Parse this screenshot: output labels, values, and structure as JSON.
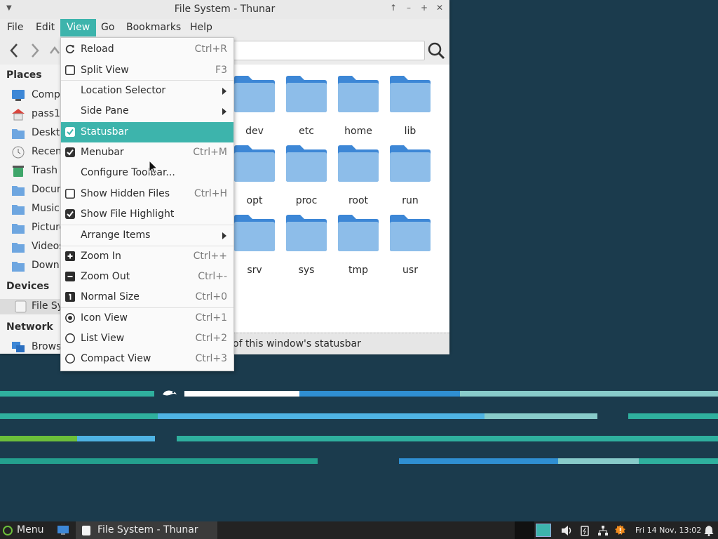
{
  "window": {
    "title": "File System - Thunar",
    "menubar": [
      "File",
      "Edit",
      "View",
      "Go",
      "Bookmarks",
      "Help"
    ],
    "active_menu": "View"
  },
  "sidebar": {
    "places_header": "Places",
    "places": [
      {
        "label": "Computer",
        "icon": "computer-icon"
      },
      {
        "label": "pass123",
        "icon": "home-icon"
      },
      {
        "label": "Desktop",
        "icon": "desktop-folder-icon"
      },
      {
        "label": "Recent",
        "icon": "clock-icon"
      },
      {
        "label": "Trash",
        "icon": "trash-icon"
      },
      {
        "label": "Documents",
        "icon": "documents-folder-icon"
      },
      {
        "label": "Music",
        "icon": "music-folder-icon"
      },
      {
        "label": "Pictures",
        "icon": "pictures-folder-icon"
      },
      {
        "label": "Videos",
        "icon": "videos-folder-icon"
      },
      {
        "label": "Downloads",
        "icon": "downloads-folder-icon"
      }
    ],
    "devices_header": "Devices",
    "devices": [
      {
        "label": "File System",
        "icon": "drive-icon"
      }
    ],
    "network_header": "Network",
    "network": [
      {
        "label": "Browse Network",
        "icon": "network-icon"
      }
    ]
  },
  "folders": [
    "dev",
    "etc",
    "home",
    "lib",
    "opt",
    "proc",
    "root",
    "run",
    "srv",
    "sys",
    "tmp",
    "usr"
  ],
  "statusbar": {
    "text": "of this window's statusbar"
  },
  "view_menu": [
    {
      "label": "Reload",
      "shortcut": "Ctrl+R",
      "marker": "reload-icon"
    },
    {
      "label": "Split View",
      "shortcut": "F3",
      "marker": "checkbox-off"
    },
    {
      "label": "Location Selector",
      "submenu": true
    },
    {
      "label": "Side Pane",
      "submenu": true
    },
    {
      "label": "Statusbar",
      "marker": "checkbox-on",
      "highlighted": true
    },
    {
      "label": "Menubar",
      "shortcut": "Ctrl+M",
      "marker": "checkbox-on"
    },
    {
      "label": "Configure Toolbar..."
    },
    {
      "label": "Show Hidden Files",
      "shortcut": "Ctrl+H",
      "marker": "checkbox-off"
    },
    {
      "label": "Show File Highlight",
      "marker": "checkbox-on"
    },
    {
      "label": "Arrange Items",
      "submenu": true
    },
    {
      "label": "Zoom In",
      "shortcut": "Ctrl++",
      "marker": "zoom-in-icon"
    },
    {
      "label": "Zoom Out",
      "shortcut": "Ctrl+-",
      "marker": "zoom-out-icon"
    },
    {
      "label": "Normal Size",
      "shortcut": "Ctrl+0",
      "marker": "normal-size-icon"
    },
    {
      "label": "Icon View",
      "shortcut": "Ctrl+1",
      "marker": "radio-on"
    },
    {
      "label": "List View",
      "shortcut": "Ctrl+2",
      "marker": "radio-off"
    },
    {
      "label": "Compact View",
      "shortcut": "Ctrl+3",
      "marker": "radio-off"
    }
  ],
  "taskbar": {
    "menu_label": "Menu",
    "task_label": "File System - Thunar",
    "clock": "Fri 14 Nov, 13:02"
  },
  "colors": {
    "accent": "#3db4ac",
    "folder": "#4a90d9",
    "desktop": "#1b3b4d",
    "taskbar": "#232323"
  }
}
